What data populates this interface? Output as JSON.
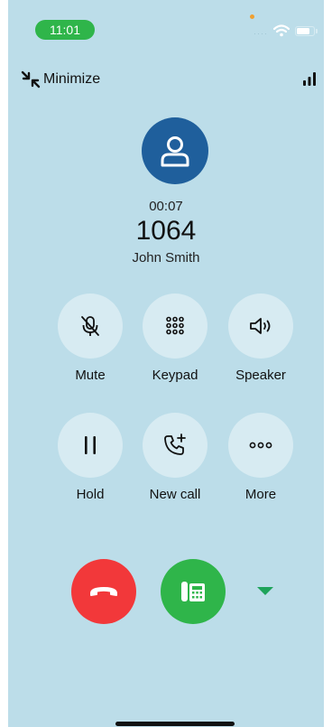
{
  "status_bar": {
    "time": "11:01"
  },
  "header": {
    "minimize_label": "Minimize"
  },
  "call": {
    "timer": "00:07",
    "number": "1064",
    "contact_name": "John Smith"
  },
  "controls": [
    {
      "label": "Mute",
      "icon": "mic-off-icon"
    },
    {
      "label": "Keypad",
      "icon": "keypad-icon"
    },
    {
      "label": "Speaker",
      "icon": "speaker-icon"
    },
    {
      "label": "Hold",
      "icon": "pause-icon"
    },
    {
      "label": "New call",
      "icon": "phone-add-icon"
    },
    {
      "label": "More",
      "icon": "more-icon"
    }
  ],
  "colors": {
    "background": "#bcdde9",
    "accent_blue": "#1f5f9c",
    "end_call_red": "#f2383a",
    "answer_green": "#2fb54a",
    "control_bg": "#d7ebf2"
  }
}
